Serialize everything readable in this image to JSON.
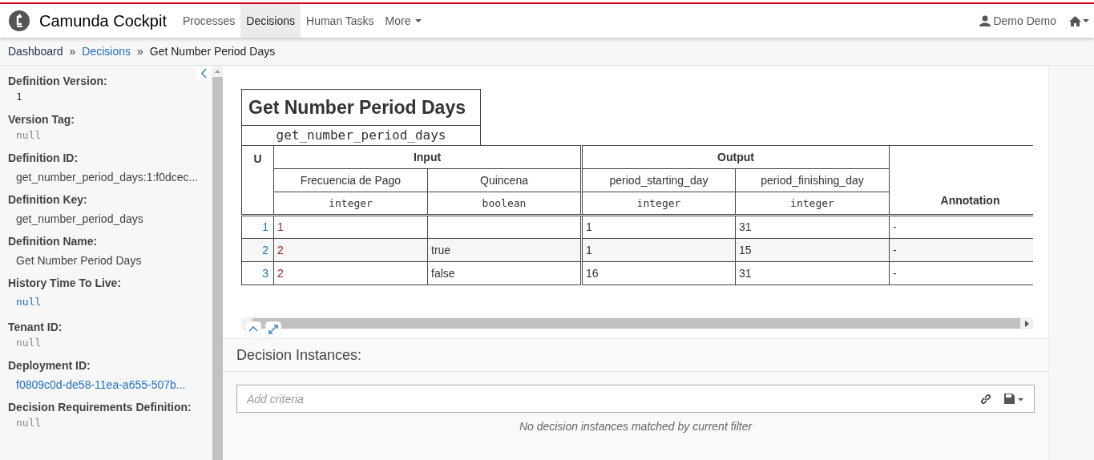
{
  "navbar": {
    "brand": "Camunda Cockpit",
    "items": [
      {
        "label": "Processes",
        "selected": false
      },
      {
        "label": "Decisions",
        "selected": true
      },
      {
        "label": "Human Tasks",
        "selected": false
      },
      {
        "label": "More",
        "selected": false
      }
    ],
    "user": "Demo Demo"
  },
  "breadcrumb": [
    {
      "label": "Dashboard",
      "kind": "home"
    },
    {
      "label": "»",
      "kind": "separator"
    },
    {
      "label": "Decisions",
      "kind": "link"
    },
    {
      "label": "»",
      "kind": "separator"
    },
    {
      "label": "Get Number Period Days",
      "kind": "current"
    }
  ],
  "sidebar": {
    "fields": [
      {
        "label": "Definition Version:",
        "value": "1",
        "kind": "code"
      },
      {
        "label": "Version Tag:",
        "value": "null",
        "kind": "null"
      },
      {
        "label": "Definition ID:",
        "value": "get_number_period_days:1:f0dcec...",
        "kind": "text"
      },
      {
        "label": "Definition Key:",
        "value": "get_number_period_days",
        "kind": "text"
      },
      {
        "label": "Definition Name:",
        "value": "Get Number Period Days",
        "kind": "text"
      },
      {
        "label": "History Time To Live:",
        "value": "null",
        "kind": "editable"
      },
      {
        "label": "Tenant ID:",
        "value": "null",
        "kind": "null"
      },
      {
        "label": "Deployment ID:",
        "value": "f0809c0d-de58-11ea-a655-507b...",
        "kind": "link"
      },
      {
        "label": "Decision Requirements Definition:",
        "value": "null",
        "kind": "null"
      }
    ]
  },
  "decision_table": {
    "title": "Get Number Period Days",
    "id": "get_number_period_days",
    "hit_policy": "U",
    "input_label": "Input",
    "output_label": "Output",
    "annotation_label": "Annotation",
    "inputs": [
      {
        "label": "Frecuencia de Pago",
        "type": "integer"
      },
      {
        "label": "Quincena",
        "type": "boolean"
      }
    ],
    "outputs": [
      {
        "label": "period_starting_day",
        "type": "integer"
      },
      {
        "label": "period_finishing_day",
        "type": "integer"
      }
    ],
    "rules": [
      {
        "number": "1",
        "cells": {
          "frecuencia": "1",
          "start": "1",
          "finish": "31"
        },
        "annotation": "-"
      },
      {
        "number": "2",
        "cells": {
          "frecuencia": "2",
          "quincena": "true",
          "start": "1",
          "finish": "15"
        },
        "annotation": "-"
      },
      {
        "number": "3",
        "cells": {
          "frecuencia": "2",
          "quincena": "false",
          "start": "16",
          "finish": "31"
        },
        "annotation": "-"
      }
    ]
  },
  "instances": {
    "heading": "Decision Instances:",
    "search_placeholder": "Add criteria",
    "empty_message": "No decision instances matched by current filter"
  }
}
